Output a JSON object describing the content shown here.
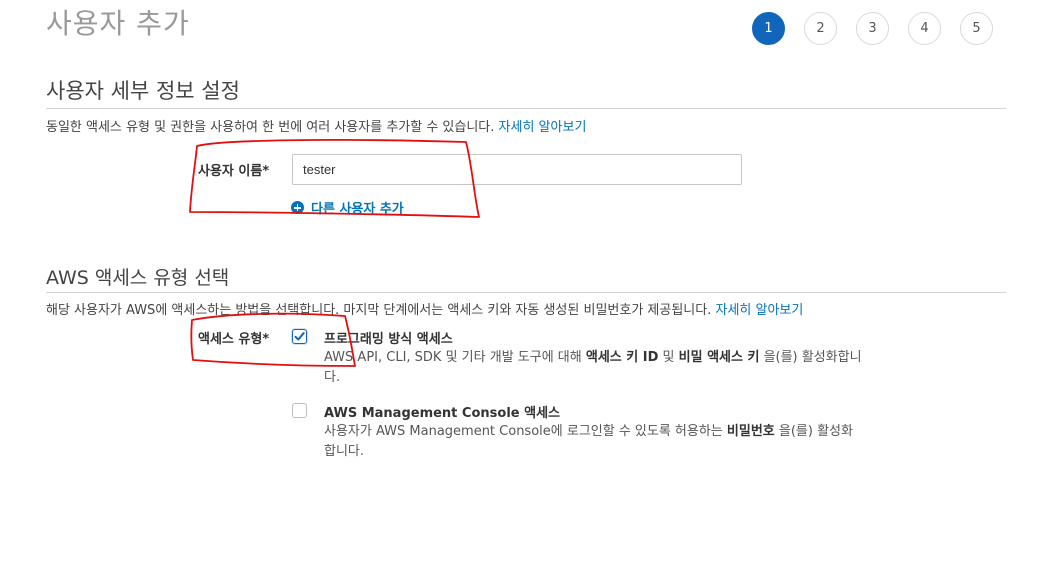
{
  "page_title": "사용자 추가",
  "steps": [
    "1",
    "2",
    "3",
    "4",
    "5"
  ],
  "active_step": "1",
  "user_details": {
    "title": "사용자 세부 정보 설정",
    "description": "동일한 액세스 유형 및 권한을 사용하여 한 번에 여러 사용자를 추가할 수 있습니다.",
    "learn_more": "자세히 알아보기",
    "username_label": "사용자 이름*",
    "username_value": "tester",
    "add_another_user": "다른 사용자 추가"
  },
  "access_type": {
    "title": "AWS 액세스 유형 선택",
    "description": "해당 사용자가 AWS에 액세스하는 방법을 선택합니다. 마지막 단계에서는 액세스 키와 자동 생성된 비밀번호가 제공됩니다.",
    "learn_more": "자세히 알아보기",
    "label": "액세스 유형*",
    "options": [
      {
        "title": "프로그래밍 방식 액세스",
        "checked": true,
        "desc_pre": "AWS API, CLI, SDK 및 기타 개발 도구에 대해 ",
        "desc_bold1": "액세스 키 ID",
        "desc_mid": " 및 ",
        "desc_bold2": "비밀 액세스 키",
        "desc_post": " 을(를) 활성화합니다."
      },
      {
        "title": "AWS Management Console 액세스",
        "checked": false,
        "desc_pre": "사용자가 AWS Management Console에 로그인할 수 있도록 허용하는 ",
        "desc_bold1": "비밀번호",
        "desc_post": " 을(를) 활성화합니다."
      }
    ]
  },
  "colors": {
    "accent": "#1166bb",
    "link": "#0073bb",
    "annotation": "#e01010"
  }
}
